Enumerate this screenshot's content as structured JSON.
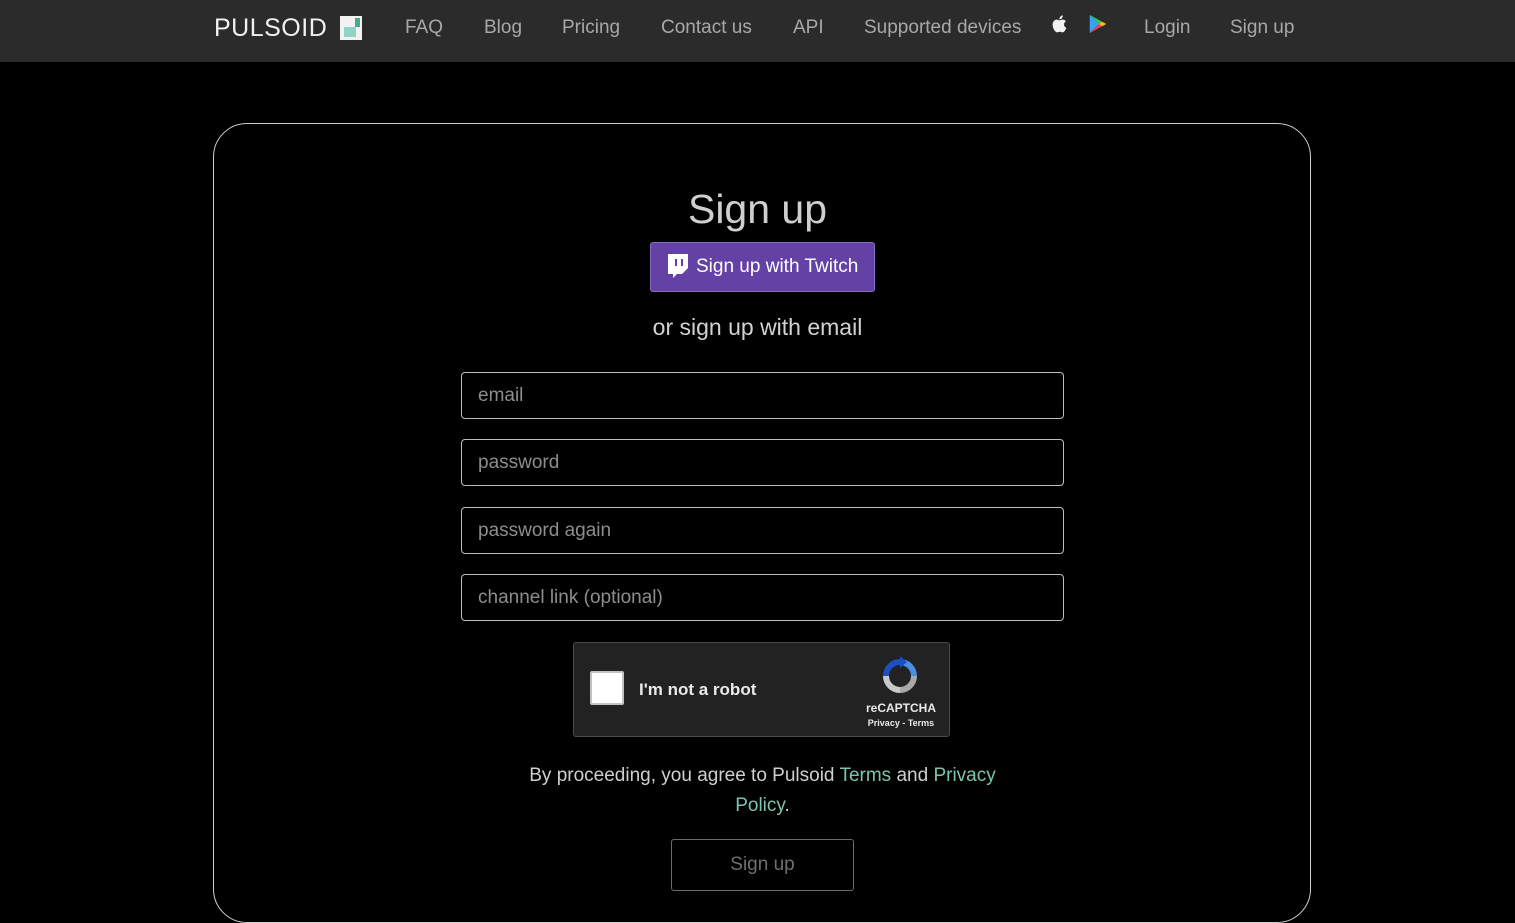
{
  "nav": {
    "brand": "PULSOID",
    "items": [
      {
        "label": "FAQ"
      },
      {
        "label": "Blog"
      },
      {
        "label": "Pricing"
      },
      {
        "label": "Contact us"
      },
      {
        "label": "API"
      },
      {
        "label": "Supported devices"
      }
    ],
    "store_icons": [
      "apple-icon",
      "google-play-icon"
    ],
    "login": "Login",
    "signup": "Sign up"
  },
  "form": {
    "title": "Sign up",
    "twitch_button": "Sign up with Twitch",
    "or_text": "or sign up with email",
    "email_placeholder": "email",
    "password_placeholder": "password",
    "password_again_placeholder": "password again",
    "channel_placeholder": "channel link (optional)",
    "submit": "Sign up"
  },
  "captcha": {
    "label": "I'm not a robot",
    "brand": "reCAPTCHA",
    "privacy": "Privacy",
    "separator": " - ",
    "terms": "Terms"
  },
  "legal": {
    "prefix": "By proceeding, you agree to Pulsoid ",
    "terms": "Terms",
    "and": " and ",
    "privacy": "Privacy Policy",
    "suffix": "."
  },
  "colors": {
    "nav_bg": "#2b2b2b",
    "twitch": "#6441a5",
    "link_accent": "#7ac4b0"
  }
}
